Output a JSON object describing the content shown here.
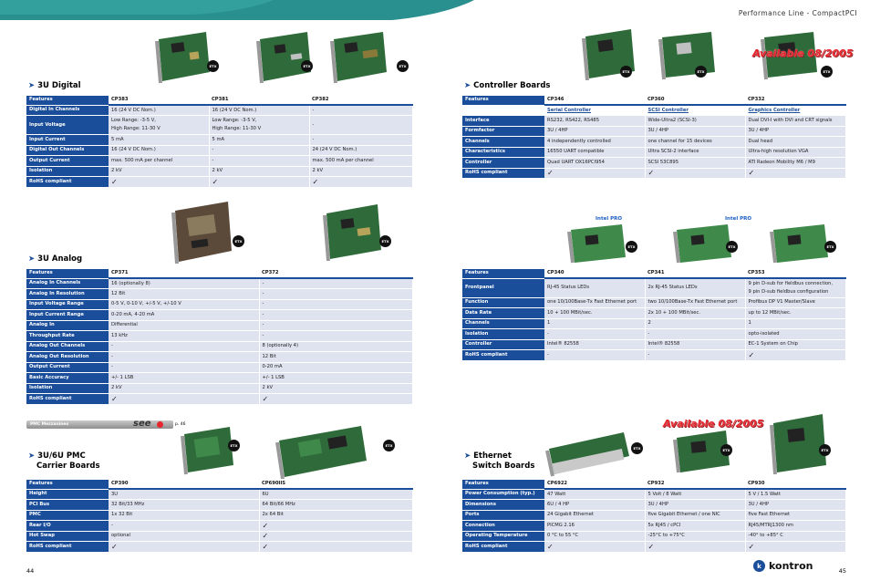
{
  "header": {
    "title": "Performance Line - CompactPCI"
  },
  "sections": {
    "digital": {
      "title": "3U Digital",
      "columns": [
        "Features",
        "CP383",
        "CP381",
        "CP382"
      ],
      "rows": [
        [
          "Digital In Channels",
          "16 (24 V DC Nom.)",
          "16 (24 V DC Nom.)",
          "-"
        ],
        [
          "Input Voltage",
          "Low Range: -3-5 V,\nHigh Range: 11-30 V",
          "Low Range: -3-5 V,\nHigh Range: 11-30 V",
          "-"
        ],
        [
          "Input Current",
          "5 mA",
          "5 mA",
          "-"
        ],
        [
          "Digital Out Channels",
          "16 (24 V DC Nom.)",
          "-",
          "24 (24 V DC Nom.)"
        ],
        [
          "Output Current",
          "max. 500 mA per channel",
          "-",
          "max. 500 mA per channel"
        ],
        [
          "Isolation",
          "2 kV",
          "2 kV",
          "2 kV"
        ],
        [
          "RoHS compliant",
          "✓",
          "✓",
          "✓"
        ]
      ]
    },
    "analog": {
      "title": "3U Analog",
      "columns": [
        "Features",
        "CP371",
        "CP372"
      ],
      "rows": [
        [
          "Analog In Channels",
          "16 (optionally 8)",
          "-"
        ],
        [
          "Analog In Resolution",
          "12 Bit",
          "-"
        ],
        [
          "Input Voltage Range",
          "0-5 V, 0-10 V, +/-5 V, +/-10 V",
          "-"
        ],
        [
          "Input Current Range",
          "0-20 mA, 4-20 mA",
          "-"
        ],
        [
          "Analog In",
          "Differential",
          "-"
        ],
        [
          "Throughput Rate",
          "13 kHz",
          "-"
        ],
        [
          "Analog Out Channels",
          "-",
          "8 (optionally 4)"
        ],
        [
          "Analog Out Resolution",
          "-",
          "12 Bit"
        ],
        [
          "Output Current",
          "-",
          "0-20 mA"
        ],
        [
          "Basic Accuracy",
          "+/- 1 LSB",
          "+/- 1 LSB"
        ],
        [
          "Isolation",
          "2 kV",
          "2 kV"
        ],
        [
          "RoHS compliant",
          "✓",
          "✓"
        ]
      ]
    },
    "pmc": {
      "title_line1": "3U/6U PMC",
      "title_line2": "Carrier Boards",
      "see_label": "PMC Mezzanines",
      "see_text": "see",
      "see_page": "p. 46",
      "columns": [
        "Features",
        "CP390",
        "CP690IIS"
      ],
      "rows": [
        [
          "Height",
          "3U",
          "6U"
        ],
        [
          "PCI Bus",
          "32 Bit/33 MHz",
          "64 Bit/66 MHz"
        ],
        [
          "PMC",
          "1x 32 Bit",
          "2x 64 Bit"
        ],
        [
          "Rear I/O",
          "-",
          "✓"
        ],
        [
          "Hot Swap",
          "optional",
          "✓"
        ],
        [
          "RoHS compliant",
          "✓",
          "✓"
        ]
      ]
    },
    "controller": {
      "title": "Controller Boards",
      "available": "Available 08/2005",
      "columns": [
        "Features",
        "CP346",
        "CP360",
        "CP332"
      ],
      "subtitles": [
        "",
        "Serial Controller",
        "SCSI Controller",
        "Graphics Controller"
      ],
      "rows": [
        [
          "Interface",
          "RS232, RS422, RS485",
          "Wide-Ultra2 (SCSI-3)",
          "Dual DVI-I with DVI and CRT signals"
        ],
        [
          "Formfactor",
          "3U / 4HP",
          "3U / 4HP",
          "3U / 4HP"
        ],
        [
          "Channels",
          "4 independently controlled",
          "one channel for 15 devices",
          "Dual head"
        ],
        [
          "Characteristics",
          "16550 UART compatible",
          "Ultra SCSI-2 interface",
          "Ultra-high resolution VGA"
        ],
        [
          "Controller",
          "Quad UART OX16PCI954",
          "SCSI 53C895",
          "ATI Radeon Mobility M6 / M9"
        ],
        [
          "RoHS compliant",
          "✓",
          "✓",
          "✓"
        ]
      ]
    },
    "network": {
      "intel_label": "Intel PRO",
      "columns": [
        "Features",
        "CP340",
        "CP341",
        "CP353"
      ],
      "rows": [
        [
          "Frontpanel",
          "RJ-45 Status LEDs",
          "2x RJ-45 Status LEDs",
          "9 pin D-sub for fieldbus connection,\n9 pin D-sub fieldbus configuration"
        ],
        [
          "Function",
          "one 10/100Base-Tx Fast Ethernet port",
          "two 10/100Base-Tx Fast Ethernet port",
          "Profibus DP V1 Master/Slave"
        ],
        [
          "Data Rate",
          "10 + 100 MBit/sec.",
          "2x 10 + 100 MBit/sec.",
          "up to 12 MBit/sec."
        ],
        [
          "Channels",
          "1",
          "2",
          "1"
        ],
        [
          "Isolation",
          "-",
          "-",
          "opto-isolated"
        ],
        [
          "Controller",
          "Intel® 82558",
          "Intel® 82558",
          "EC-1 System on Chip"
        ],
        [
          "RoHS compliant",
          "-",
          "-",
          "✓"
        ]
      ]
    },
    "ethernet": {
      "title_line1": "Ethernet",
      "title_line2": "Switch Boards",
      "available": "Available 08/2005",
      "columns": [
        "Features",
        "CP6922",
        "CP932",
        "CP930"
      ],
      "rows": [
        [
          "Power Consumption (typ.)",
          "47 Watt",
          "5 Volt / 8 Watt",
          "5 V / 1.5 Watt"
        ],
        [
          "Dimensions",
          "6U / 4 HP",
          "3U / 4HP",
          "3U / 4HP"
        ],
        [
          "Ports",
          "24 Gigabit Ethernet",
          "five Gigabit Ethernet / one NIC",
          "five Fast Ethernet"
        ],
        [
          "Connection",
          "PICMG 2.16",
          "5x RJ45 / cPCI",
          "RJ45/MTRJ1300 nm"
        ],
        [
          "Operating Temperature",
          "0 °C to 55 °C",
          "-25°C to +75°C",
          "-40° to +85° C"
        ],
        [
          "RoHS compliant",
          "✓",
          "✓",
          "✓"
        ]
      ]
    }
  },
  "etx_badge": "ETX",
  "footer": {
    "page_left": "44",
    "page_right": "45",
    "logo": "kontron",
    "logo_mark": "k"
  },
  "colors": {
    "accent": "#1a4d9a",
    "teal": "#2a8f8f",
    "cell": "#dfe3ef",
    "red": "#e8252d"
  }
}
